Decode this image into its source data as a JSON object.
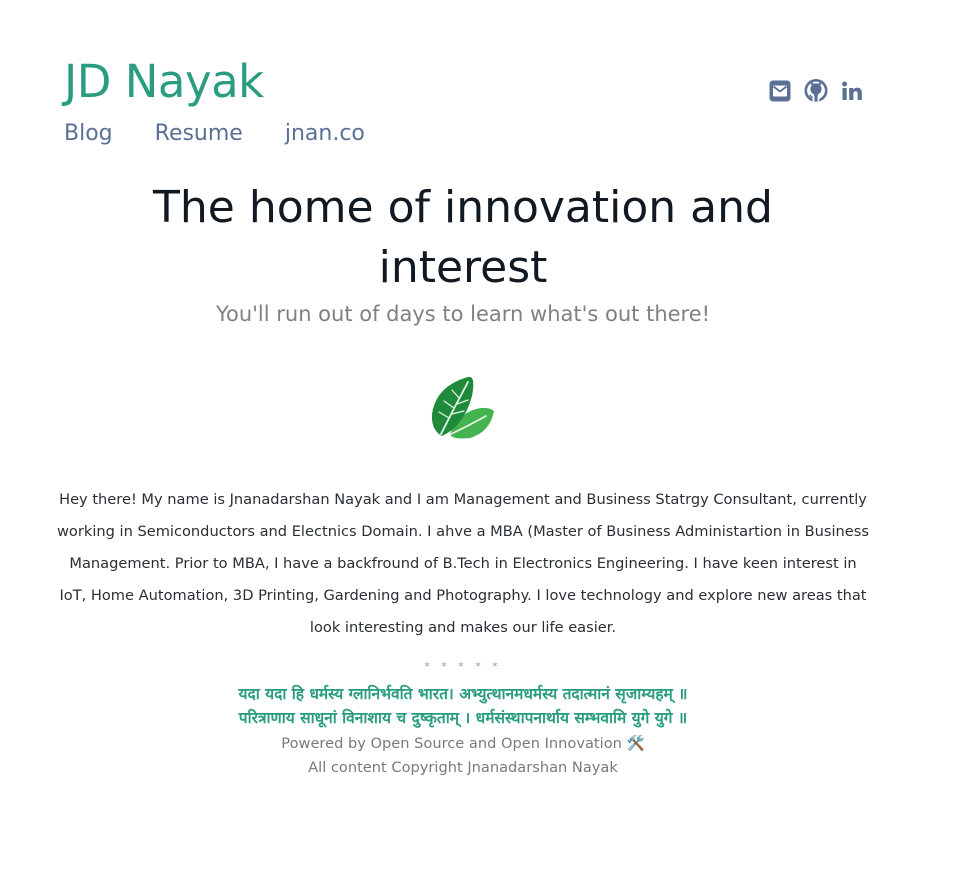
{
  "header": {
    "site_title": "JD Nayak",
    "nav": {
      "blog": "Blog",
      "resume": "Resume",
      "jnan": "jnan.co"
    },
    "social_icons": [
      "envelope-icon",
      "github-icon",
      "linkedin-icon"
    ],
    "icon_color": "#5a7095"
  },
  "hero": {
    "title": "The home of innovation and interest",
    "subtitle": "You'll run out of days to learn what's out there!",
    "image_icon": "mint-leaf-icon"
  },
  "bio": "Hey there! My name is Jnanadarshan Nayak and I am Management and Business Statrgy Consultant, currently working in Semiconductors and Electnics Domain. I ahve a MBA (Master of Business Administartion in Business Management. Prior to MBA, I have a backfround of B.Tech in Electronics Engineering. I have keen interest in IoT, Home Automation, 3D Printing, Gardening and Photography. I love technology and explore new areas that look interesting and makes our life easier.",
  "footer": {
    "divider": "* * * * *",
    "shloka_line1": "यदा यदा हि धर्मस्य ग्लानिर्भवति भारत। अभ्युत्थानमधर्मस्य तदात्मानं सृजाम्यहम् ॥",
    "shloka_line2": "परित्राणाय साधूनां विनाशाय च दुष्कृताम् । धर्मसंस्थापनार्थाय सम्भवामि युगे युगे ॥",
    "powered_by": "Powered by Open Source and Open Innovation 🛠️",
    "copyright": "All content Copyright Jnanadarshan Nayak"
  },
  "colors": {
    "accent": "#2a9d80",
    "nav": "#5a7095",
    "heading": "#111a22",
    "muted": "#808080"
  }
}
